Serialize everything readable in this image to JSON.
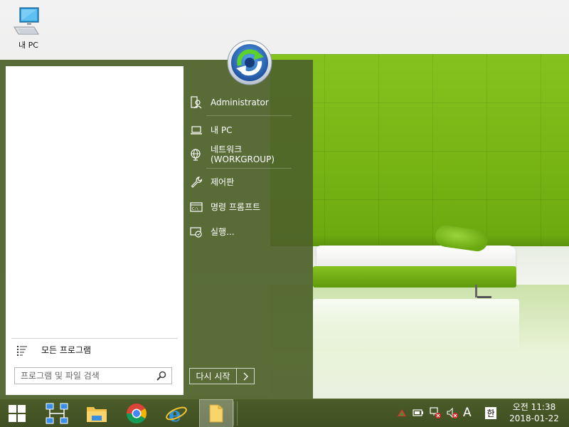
{
  "desktop": {
    "icons": [
      {
        "label": "내 PC",
        "icon": "computer-icon"
      }
    ]
  },
  "start_menu": {
    "all_programs": {
      "label": "모든 프로그램",
      "icon": "list-icon"
    },
    "search": {
      "placeholder": "프로그램 및 파일 검색",
      "icon": "search-icon"
    },
    "user_avatar_icon": "refresh-arrow-icon",
    "right_items": [
      {
        "label": "Administrator",
        "icon": "user-icon"
      },
      {
        "label": "내 PC",
        "icon": "laptop-icon"
      },
      {
        "label": "네트워크\n(WORKGROUP)",
        "icon": "globe-network-icon"
      },
      {
        "label": "제어판",
        "icon": "wrench-icon"
      },
      {
        "label": "명령 프롬프트",
        "icon": "command-prompt-icon"
      },
      {
        "label": "실행...",
        "icon": "run-icon"
      }
    ],
    "restart": {
      "label": "다시 시작",
      "arrow_icon": "chevron-right-icon"
    }
  },
  "taskbar": {
    "start_icon": "windows-logo-icon",
    "apps": [
      {
        "name": "network-app",
        "icon": "network-diagram-icon"
      },
      {
        "name": "file-explorer",
        "icon": "folder-icon"
      },
      {
        "name": "chrome",
        "icon": "chrome-icon"
      },
      {
        "name": "internet-explorer",
        "icon": "ie-icon"
      },
      {
        "name": "folder-window",
        "icon": "open-folder-icon",
        "active": true
      }
    ],
    "tray": {
      "icons": [
        "arrow-up-icon",
        "battery-icon",
        "network-error-icon",
        "volume-mute-icon"
      ],
      "ime_mode": "A",
      "hangul": "한",
      "time": "오전 11:38",
      "date": "2018-01-22"
    }
  },
  "colors": {
    "start_menu_bg": "#4d622a",
    "taskbar_bg": "#45562a",
    "accent_green": "#7ab517"
  }
}
